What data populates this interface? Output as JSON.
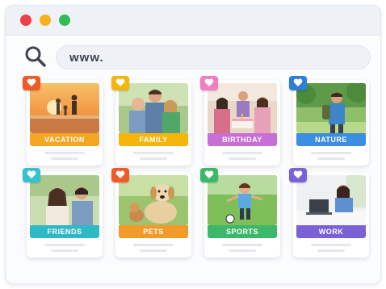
{
  "browser": {
    "url_text": "www.",
    "window_buttons": [
      "close",
      "minimize",
      "maximize"
    ]
  },
  "cards": [
    {
      "label": "VACATION",
      "label_color": "#f5a623",
      "badge_color": "#f05a28",
      "icon": "heart-icon",
      "scene": "beach sunset"
    },
    {
      "label": "FAMILY",
      "label_color": "#f5b50a",
      "badge_color": "#f5b50a",
      "icon": "heart-icon",
      "scene": "family portrait"
    },
    {
      "label": "BIRTHDAY",
      "label_color": "#c76fd6",
      "badge_color": "#ef7fc0",
      "icon": "heart-icon",
      "scene": "birthday cake"
    },
    {
      "label": "NATURE",
      "label_color": "#3d8ee0",
      "badge_color": "#2f7fd9",
      "icon": "heart-icon",
      "scene": "hiker in forest"
    },
    {
      "label": "FRIENDS",
      "label_color": "#2fb8c6",
      "badge_color": "#35c2cf",
      "icon": "heart-icon",
      "scene": "friends smiling"
    },
    {
      "label": "PETS",
      "label_color": "#f39a2a",
      "badge_color": "#f05a28",
      "icon": "heart-icon",
      "scene": "dog on grass"
    },
    {
      "label": "SPORTS",
      "label_color": "#3db86a",
      "badge_color": "#3db86a",
      "icon": "heart-icon",
      "scene": "kid playing soccer"
    },
    {
      "label": "WORK",
      "label_color": "#7b61d6",
      "badge_color": "#7b61d6",
      "icon": "heart-icon",
      "scene": "woman at laptop"
    }
  ]
}
